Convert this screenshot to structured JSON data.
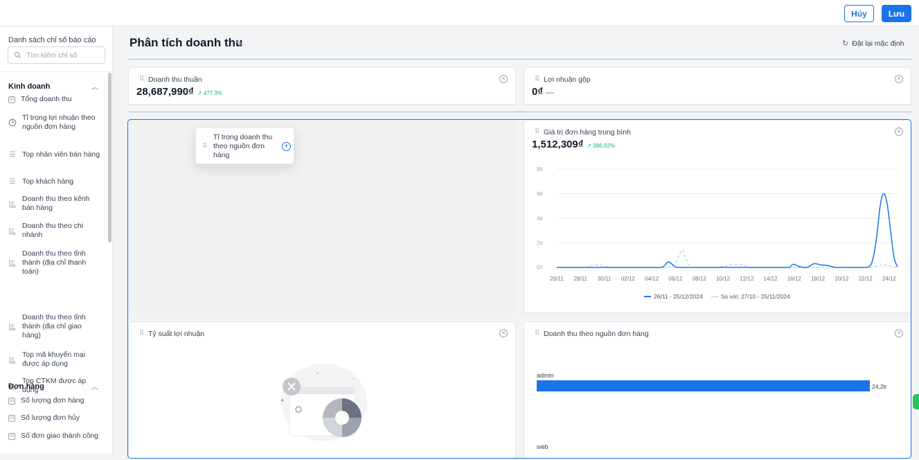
{
  "toolbar": {
    "cancel_label": "Hủy",
    "save_label": "Lưu"
  },
  "sidebar": {
    "title": "Danh sách chỉ số báo cáo",
    "search_placeholder": "Tìm kiếm chỉ số",
    "groups": [
      {
        "label": "Kinh doanh",
        "items": [
          {
            "label": "Tổng doanh thu",
            "icon": "number-box-icon"
          },
          {
            "label": "Tỉ trọng lợi nhuận theo nguồn đơn hàng",
            "icon": "pie-clock-icon"
          },
          {
            "label": "Top nhân viên bán hàng",
            "icon": "list-icon"
          },
          {
            "label": "Top khách hàng",
            "icon": "list-icon"
          },
          {
            "label": "Doanh thu theo kênh bán hàng",
            "icon": "bar-chart-icon"
          },
          {
            "label": "Doanh thu theo chi nhánh",
            "icon": "bar-chart-icon"
          },
          {
            "label": "Doanh thu theo tỉnh thành (địa chỉ thanh toán)",
            "icon": "bar-chart-icon"
          },
          {
            "label": "Doanh thu theo tỉnh thành (địa chỉ giao hàng)",
            "icon": "bar-chart-icon"
          },
          {
            "label": "Top mã khuyến mại được áp dụng",
            "icon": "bar-chart-icon"
          },
          {
            "label": "Top CTKM được áp dụng",
            "icon": "bar-chart-icon"
          }
        ]
      },
      {
        "label": "Đơn hàng",
        "items": [
          {
            "label": "Số lượng đơn hàng",
            "icon": "number-box-icon"
          },
          {
            "label": "Số lượng đơn hủy",
            "icon": "number-box-icon"
          },
          {
            "label": "Số đơn giao thành công",
            "icon": "number-box-icon"
          }
        ]
      }
    ]
  },
  "main": {
    "title": "Phân tích doanh thu",
    "reset_label": "Đặt lại mặc định",
    "cards": {
      "net_revenue": {
        "title": "Doanh thu thuần",
        "value": "28,687,990₫",
        "delta": "↗ 477.3%"
      },
      "gross_profit": {
        "title": "Lợi nhuận gộp",
        "value": "0₫",
        "dash": "—"
      },
      "avg_order": {
        "title": "Giá trị đơn hàng trung bình",
        "value": "1,512,309₫",
        "delta": "↗ 386.92%"
      },
      "profit_margin": {
        "title": "Tỷ suất lợi nhuận"
      },
      "revenue_by_source": {
        "title": "Doanh thu theo nguồn đơn hàng"
      }
    },
    "drag_preview": {
      "label": "Tỉ trọng doanh thu theo nguồn đơn hàng"
    }
  },
  "chart_data": [
    {
      "type": "line",
      "y_ticks": [
        "0₫",
        "2tr",
        "4tr",
        "6tr",
        "8tr"
      ],
      "ylim": [
        0,
        8
      ],
      "x_ticks": [
        "26/11",
        "28/11",
        "30/11",
        "02/12",
        "04/12",
        "06/12",
        "08/12",
        "10/12",
        "12/12",
        "14/12",
        "16/12",
        "18/12",
        "20/12",
        "22/12",
        "24/12"
      ],
      "grid": true,
      "legend_position": "bottom",
      "series": [
        {
          "name": "26/11 - 25/12/2024",
          "color": "#1a73e8",
          "x_index": [
            0,
            2,
            4,
            6,
            8,
            10,
            12,
            14,
            16,
            17,
            18,
            19,
            20,
            22,
            24,
            26,
            28,
            30,
            31,
            32,
            33,
            34,
            35,
            36,
            37,
            38,
            40,
            42,
            44,
            45,
            46,
            47,
            48,
            49,
            50,
            51,
            52,
            54,
            56,
            57,
            58,
            59,
            60,
            61,
            62,
            63,
            64,
            65,
            66,
            67,
            68,
            70,
            72,
            74,
            76,
            78,
            80,
            82,
            84,
            86,
            88,
            90,
            91,
            92,
            93,
            94,
            95,
            96,
            97,
            98
          ],
          "values": [
            0,
            0,
            0,
            0,
            0,
            0,
            0,
            0,
            0,
            0,
            0,
            0,
            0,
            0,
            0,
            0,
            0,
            0,
            0.15,
            0.45,
            0.3,
            0.05,
            0,
            0,
            0,
            0,
            0,
            0,
            0,
            0,
            0,
            0,
            0,
            0,
            0,
            0,
            0,
            0,
            0,
            0,
            0,
            0,
            0,
            0,
            0,
            0,
            0,
            0,
            0,
            0,
            0.25,
            0.05,
            0,
            0.3,
            0.2,
            0.15,
            0,
            0,
            0,
            0,
            0,
            0.1,
            0.8,
            2.5,
            5.0,
            6.0,
            5.2,
            3.0,
            0.8,
            0.05
          ]
        },
        {
          "name": "So với: 27/10 - 25/11/2024",
          "color": "#93c5fd",
          "x_index": [
            0,
            4,
            8,
            10,
            12,
            14,
            16,
            20,
            24,
            28,
            32,
            34,
            36,
            37,
            38,
            39,
            40,
            42,
            46,
            50,
            52,
            54,
            56,
            58,
            62,
            66,
            70,
            74,
            78,
            82,
            86,
            90,
            94,
            98
          ],
          "values": [
            0,
            0,
            0,
            0.15,
            0.2,
            0.1,
            0,
            0,
            0,
            0,
            0,
            0.3,
            1.4,
            0.8,
            0.2,
            0,
            0,
            0,
            0,
            0.2,
            0.25,
            0.15,
            0,
            0,
            0,
            0,
            0,
            0,
            0,
            0,
            0,
            0,
            0.2,
            0
          ]
        }
      ]
    },
    {
      "type": "bar",
      "orientation": "horizontal",
      "categories": [
        "admin",
        "web"
      ],
      "values": [
        24.2,
        null
      ],
      "data_labels": [
        "24,2tr",
        ""
      ],
      "unit": "tr"
    }
  ]
}
